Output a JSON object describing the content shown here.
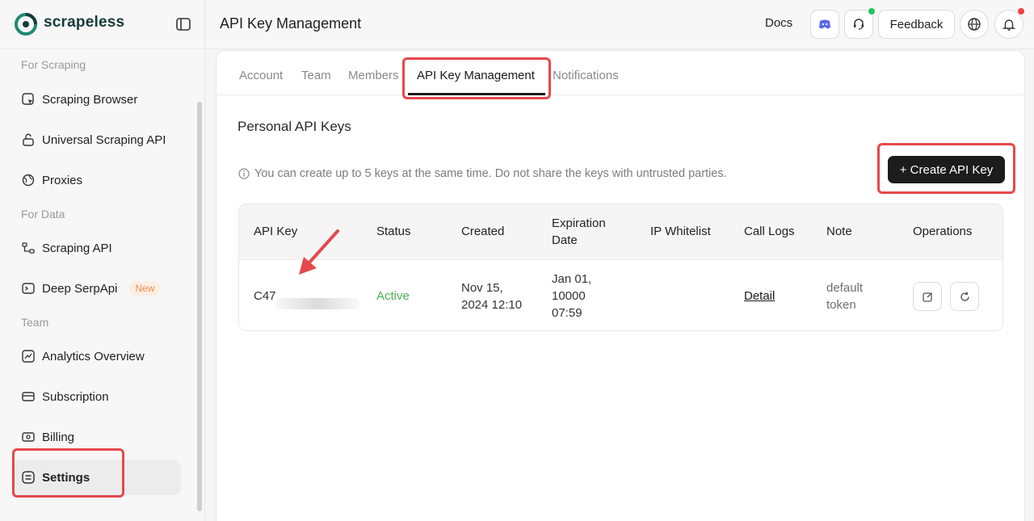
{
  "brand": {
    "name": "scrapeless"
  },
  "sidebar": {
    "sections": [
      {
        "label": "For Scraping"
      },
      {
        "label": "For Data"
      },
      {
        "label": "Team"
      }
    ],
    "items": [
      {
        "label": "Scraping Browser"
      },
      {
        "label": "Universal Scraping API"
      },
      {
        "label": "Proxies"
      },
      {
        "label": "Scraping API"
      },
      {
        "label": "Deep SerpApi",
        "badge": "New"
      },
      {
        "label": "Analytics Overview"
      },
      {
        "label": "Subscription"
      },
      {
        "label": "Billing"
      },
      {
        "label": "Settings",
        "active": true
      }
    ]
  },
  "header": {
    "title": "API Key Management",
    "docs": "Docs",
    "feedback": "Feedback"
  },
  "tabs": [
    {
      "label": "Account"
    },
    {
      "label": "Team"
    },
    {
      "label": "Members"
    },
    {
      "label": "API Key Management",
      "active": true
    },
    {
      "label": "Notifications"
    }
  ],
  "main": {
    "section_title": "Personal API Keys",
    "info_text": "You can create up to 5 keys at the same time. Do not share the keys with untrusted parties.",
    "create_button": "+ Create API Key"
  },
  "table": {
    "columns": [
      "API Key",
      "Status",
      "Created",
      "Expiration Date",
      "IP Whitelist",
      "Call Logs",
      "Note",
      "Operations"
    ],
    "rows": [
      {
        "api_key": "C47",
        "status": "Active",
        "created": "Nov 15, 2024 12:10",
        "expiration": "Jan 01, 10000 07:59",
        "ip_whitelist": "",
        "call_logs": "Detail",
        "note": "default token"
      }
    ]
  },
  "colors": {
    "accent": "#1c1c1c",
    "status_active": "#4caf50",
    "highlight": "#e5484d",
    "badge_new_text": "#ee8b4b",
    "badge_new_bg": "#fdeee3"
  }
}
